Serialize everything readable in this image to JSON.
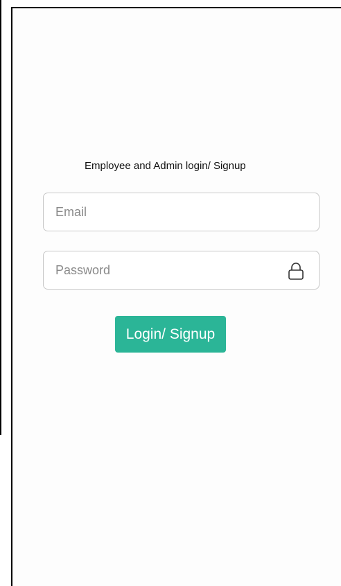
{
  "login": {
    "heading": "Employee and Admin login/ Signup",
    "email": {
      "placeholder": "Email",
      "value": ""
    },
    "password": {
      "placeholder": "Password",
      "value": "",
      "icon": "lock-icon"
    },
    "submit_label": "Login/ Signup"
  },
  "colors": {
    "accent": "#2bb597",
    "border": "#c8c8c8",
    "frame": "#000000"
  }
}
